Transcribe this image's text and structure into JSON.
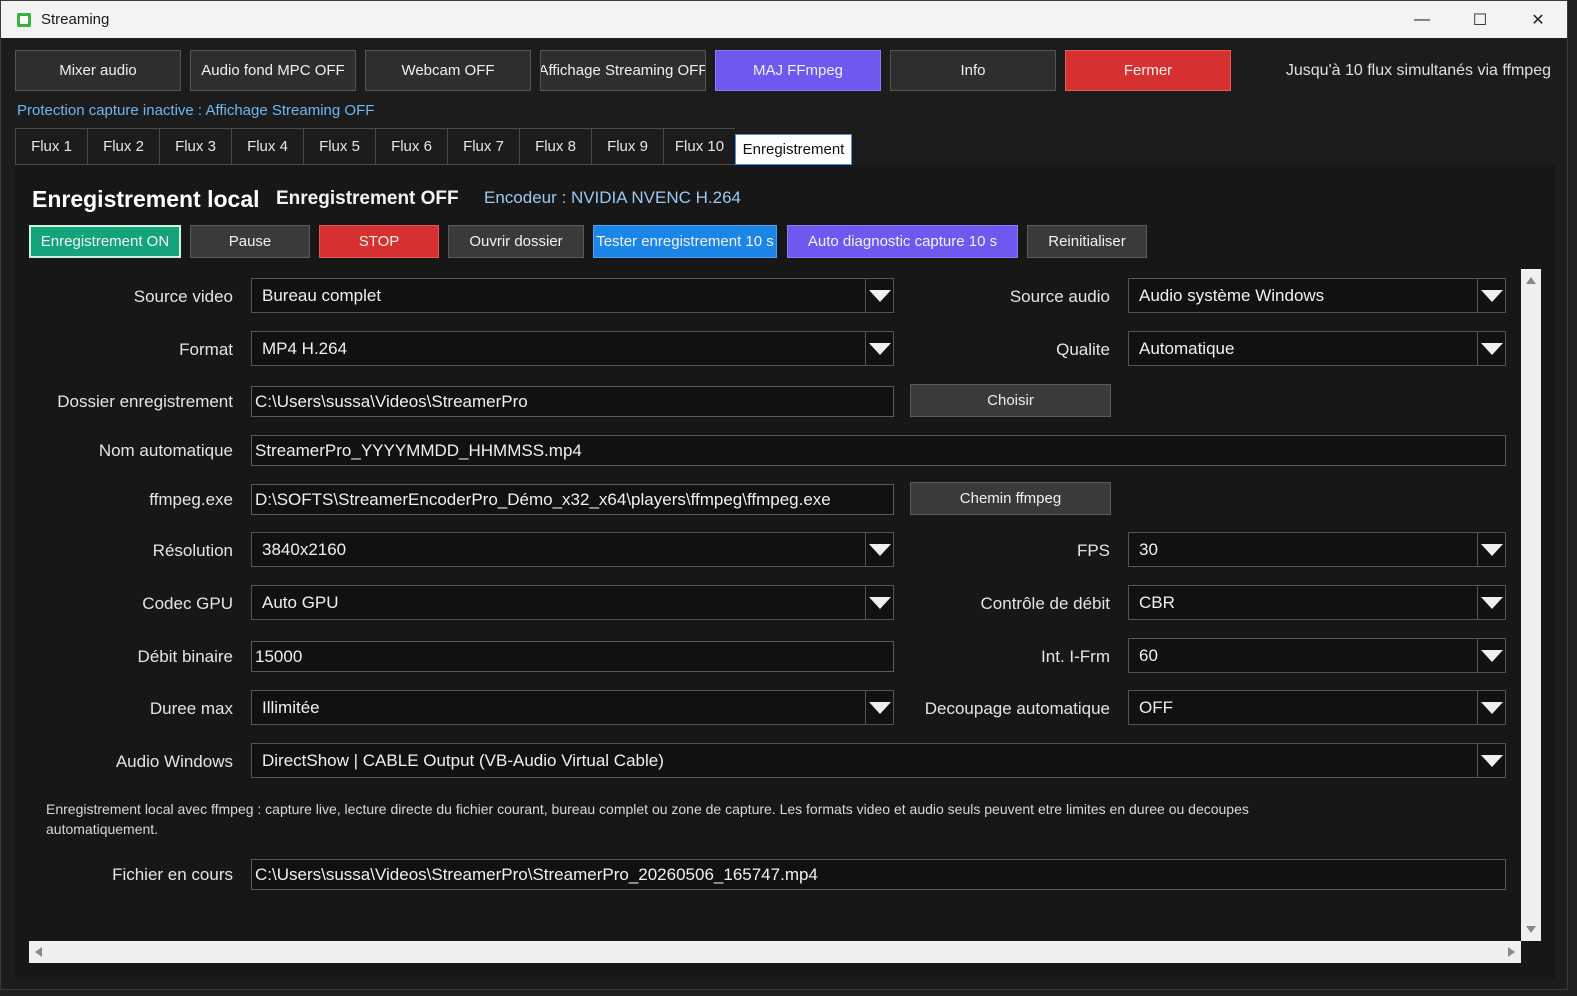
{
  "window": {
    "title": "Streaming"
  },
  "toolbar": {
    "buttons": [
      {
        "label": "Mixer audio"
      },
      {
        "label": "Audio fond MPC OFF"
      },
      {
        "label": "Webcam OFF"
      },
      {
        "label": "Affichage Streaming OFF"
      },
      {
        "label": "MAJ FFmpeg"
      },
      {
        "label": "Info"
      },
      {
        "label": "Fermer"
      }
    ],
    "info": "Jusqu'à 10 flux simultanés via ffmpeg"
  },
  "protection_status": "Protection capture inactive : Affichage Streaming OFF",
  "tabs": [
    "Flux 1",
    "Flux 2",
    "Flux 3",
    "Flux 4",
    "Flux 5",
    "Flux 6",
    "Flux 7",
    "Flux 8",
    "Flux 9",
    "Flux 10",
    "Enregistrement"
  ],
  "panel": {
    "title": "Enregistrement local",
    "status": "Enregistrement OFF",
    "encoder": "Encodeur : NVIDIA NVENC H.264",
    "actions": {
      "record_on": "Enregistrement ON",
      "pause": "Pause",
      "stop": "STOP",
      "open_folder": "Ouvrir dossier",
      "test": "Tester enregistrement 10 s",
      "auto_diag": "Auto diagnostic capture 10 s",
      "reset": "Reinitialiser"
    },
    "form": {
      "source_video": {
        "label": "Source video",
        "value": "Bureau complet"
      },
      "source_audio": {
        "label": "Source audio",
        "value": "Audio système Windows"
      },
      "format": {
        "label": "Format",
        "value": "MP4 H.264"
      },
      "quality": {
        "label": "Qualite",
        "value": "Automatique"
      },
      "folder": {
        "label": "Dossier enregistrement",
        "value": "C:\\Users\\sussa\\Videos\\StreamerPro",
        "button": "Choisir"
      },
      "auto_name": {
        "label": "Nom automatique",
        "value": "StreamerPro_YYYYMMDD_HHMMSS.mp4"
      },
      "ffmpeg": {
        "label": "ffmpeg.exe",
        "value": "D:\\SOFTS\\StreamerEncoderPro_Démo_x32_x64\\players\\ffmpeg\\ffmpeg.exe",
        "button": "Chemin ffmpeg"
      },
      "resolution": {
        "label": "Résolution",
        "value": "3840x2160"
      },
      "fps": {
        "label": "FPS",
        "value": "30"
      },
      "codec": {
        "label": "Codec GPU",
        "value": "Auto GPU"
      },
      "rate_control": {
        "label": "Contrôle de débit",
        "value": "CBR"
      },
      "bitrate": {
        "label": "Débit binaire",
        "value": "15000"
      },
      "iframe": {
        "label": "Int. I-Frm",
        "value": "60"
      },
      "max_duration": {
        "label": "Duree max",
        "value": "Illimitée"
      },
      "auto_split": {
        "label": "Decoupage automatique",
        "value": "OFF"
      },
      "audio_windows": {
        "label": "Audio Windows",
        "value": "DirectShow | CABLE Output (VB-Audio Virtual Cable)"
      },
      "note": "Enregistrement local avec ffmpeg : capture live, lecture directe du fichier courant, bureau complet ou zone de capture. Les formats video et audio seuls peuvent etre limites en duree ou decoupes automatiquement.",
      "current_file": {
        "label": "Fichier en cours",
        "value": "C:\\Users\\sussa\\Videos\\StreamerPro\\StreamerPro_20260506_165747.mp4"
      }
    }
  }
}
